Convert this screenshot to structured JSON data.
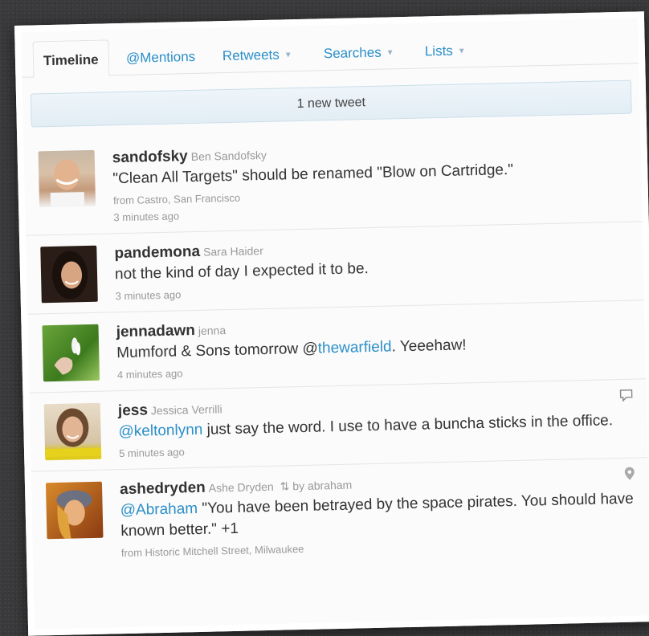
{
  "tabs": [
    {
      "label": "Timeline"
    },
    {
      "label": "@Mentions"
    },
    {
      "label": "Retweets"
    },
    {
      "label": "Searches"
    },
    {
      "label": "Lists"
    }
  ],
  "new_tweet_banner": "1 new tweet",
  "tweets": [
    {
      "username": "sandofsky",
      "realname": "Ben Sandofsky",
      "text": "\"Clean All Targets\" should be renamed \"Blow on Cartridge.\"",
      "location": "from Castro, San Francisco",
      "time": "3 minutes ago"
    },
    {
      "username": "pandemona",
      "realname": "Sara Haider",
      "text": "not the kind of day I expected it to be.",
      "time": "3 minutes ago"
    },
    {
      "username": "jennadawn",
      "realname": "jenna",
      "text_pre": "Mumford & Sons tomorrow @",
      "mention": "thewarfield",
      "text_post": ". Yeeehaw!",
      "time": "4 minutes ago"
    },
    {
      "username": "jess",
      "realname": "Jessica Verrilli",
      "mention_prefix": "@",
      "mention": "keltonlynn",
      "text_post": " just say the word. I use to have a buncha sticks in the office.",
      "time": "5 minutes ago"
    },
    {
      "username": "ashedryden",
      "realname": "Ashe Dryden",
      "retweeted_by": "by abraham",
      "mention_prefix": "@",
      "mention": "Abraham",
      "text_post": " \"You have been betrayed by the space pirates. You should have known better.\" +1",
      "location": "from Historic Mitchell Street, Milwaukee"
    }
  ]
}
